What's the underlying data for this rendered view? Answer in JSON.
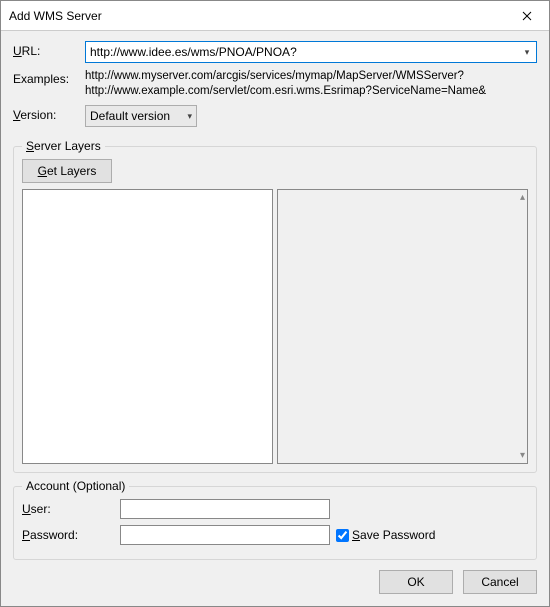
{
  "window": {
    "title": "Add WMS Server"
  },
  "labels": {
    "url_pre": "U",
    "url_suf": "RL:",
    "examples": "Examples:",
    "version_pre": "V",
    "version_suf": "ersion:",
    "server_layers_pre": "S",
    "server_layers_suf": "erver Layers",
    "get_layers_pre": "G",
    "get_layers_suf": "et Layers",
    "account": "Account (Optional)",
    "user_pre": "U",
    "user_suf": "ser:",
    "password_pre": "P",
    "password_suf": "assword:",
    "save_pre": "S",
    "save_suf": "ave Password",
    "ok": "OK",
    "cancel": "Cancel"
  },
  "fields": {
    "url": "http://www.idee.es/wms/PNOA/PNOA?",
    "examples_line1": "http://www.myserver.com/arcgis/services/mymap/MapServer/WMSServer?",
    "examples_line2": "http://www.example.com/servlet/com.esri.wms.Esrimap?ServiceName=Name&",
    "version": "Default version",
    "user": "",
    "password": "",
    "save_password": true
  }
}
